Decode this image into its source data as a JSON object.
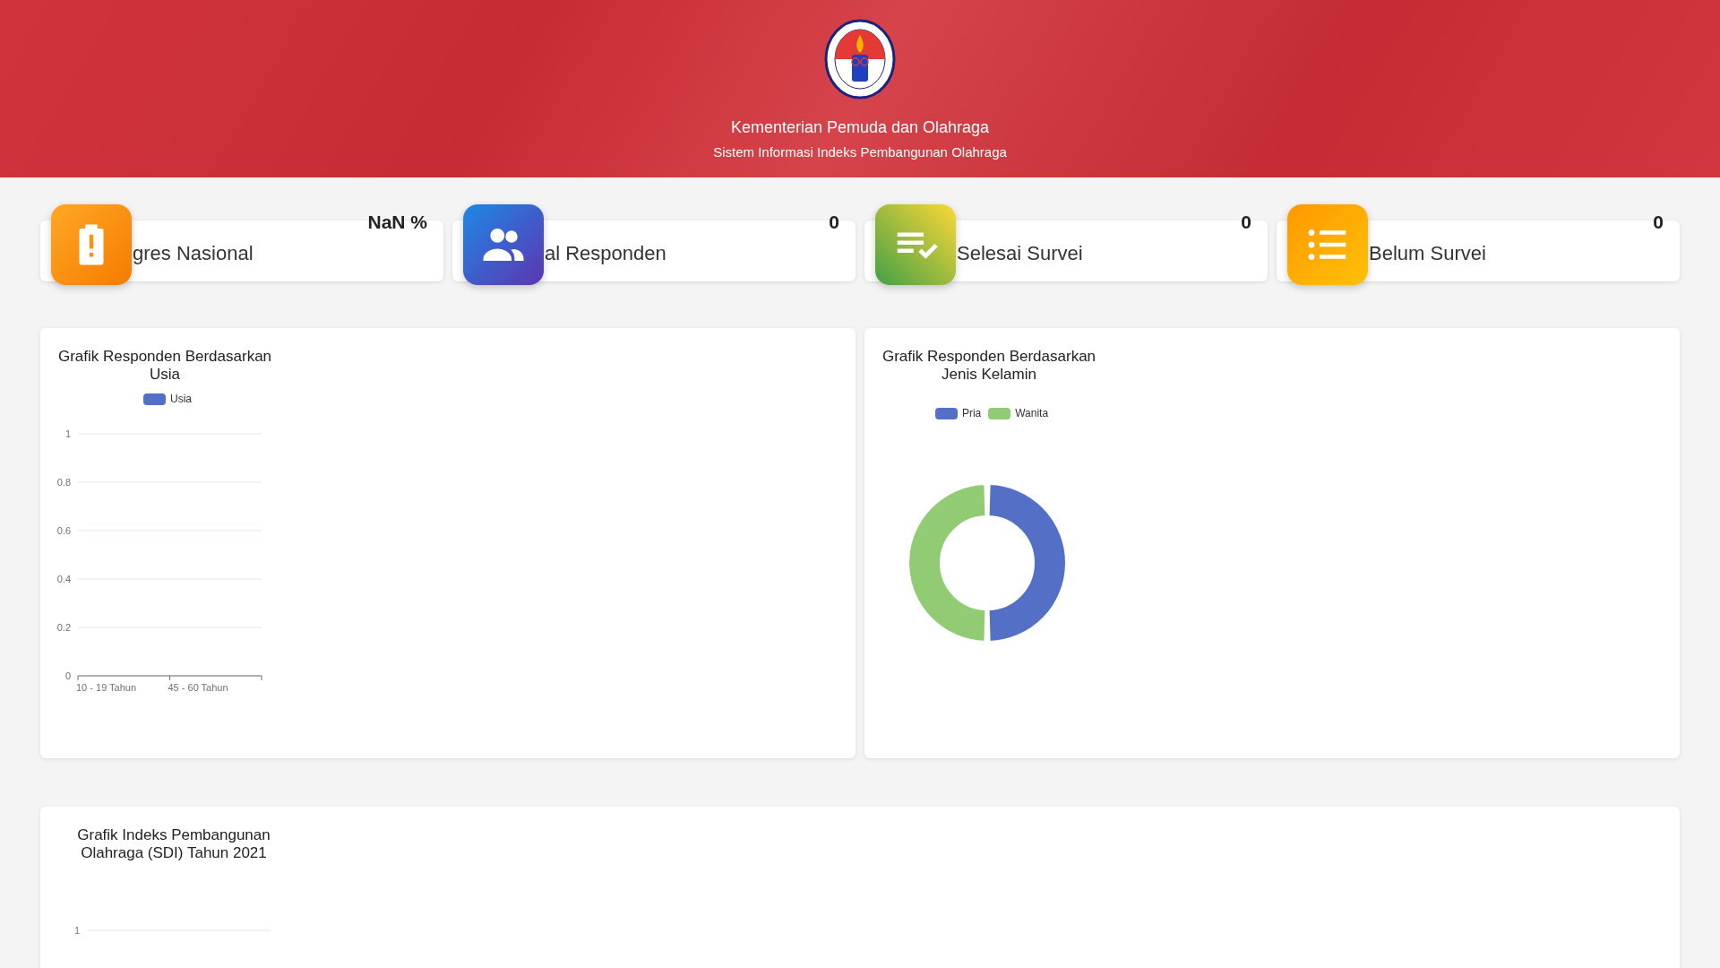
{
  "header": {
    "title": "Kementerian Pemuda dan Olahraga",
    "subtitle": "Sistem Informasi Indeks Pembangunan Olahraga"
  },
  "stats": [
    {
      "kind": "battery",
      "label": "gres Nasional",
      "value": "NaN %"
    },
    {
      "kind": "people",
      "label": "al Responden",
      "value": "0"
    },
    {
      "kind": "checklist",
      "label": "Selesai Survei",
      "value": "0"
    },
    {
      "kind": "list",
      "label": "Belum Survei",
      "value": "0"
    }
  ],
  "charts": [
    {
      "chart_data": {
        "type": "bar",
        "title": "Grafik Responden Berdasarkan Usia",
        "categories": [
          "10 - 19 Tahun",
          "45 - 60 Tahun"
        ],
        "series": [
          {
            "name": "Usia",
            "color": "#5470c6",
            "values": [
              0,
              0
            ]
          }
        ],
        "ylim": [
          0,
          1
        ],
        "yticks": [
          0,
          0.2,
          0.4,
          0.6,
          0.8,
          1
        ],
        "grid": true,
        "legend": "top"
      }
    },
    {
      "chart_data": {
        "type": "donut",
        "title": "Grafik Responden Berdasarkan Jenis Kelamin",
        "categories": [
          "Pria",
          "Wanita"
        ],
        "values": [
          50,
          50
        ],
        "colors": [
          "#5470c6",
          "#91cc75"
        ],
        "legend": "top"
      }
    },
    {
      "chart_data": {
        "type": "other",
        "title": "Grafik Indeks Pembangunan Olahraga (SDI) Tahun 2021",
        "annotations": [
          {
            "text": "1"
          }
        ]
      }
    }
  ]
}
